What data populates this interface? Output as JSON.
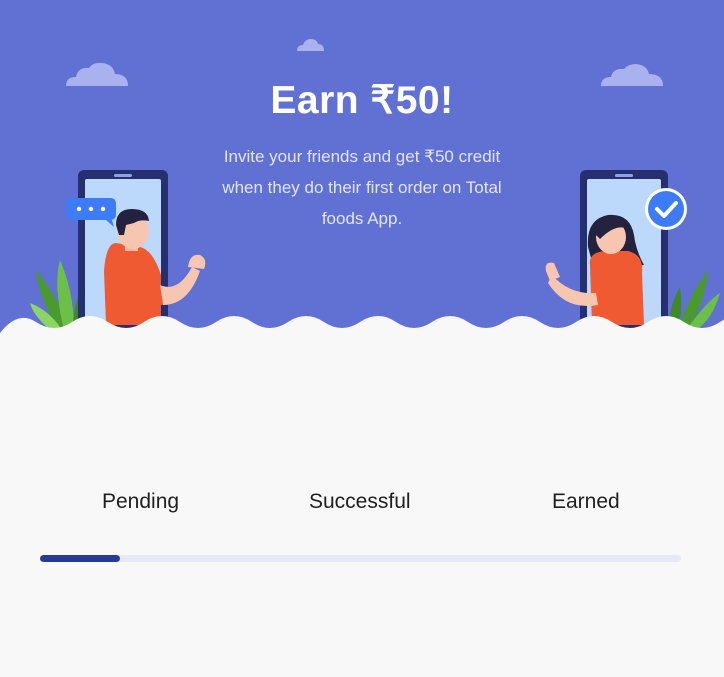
{
  "hero": {
    "title": "Earn ₹50!",
    "subtitle": "Invite your friends and get ₹50 credit when they do their first order on Total foods App."
  },
  "colors": {
    "hero_bg": "#6170d3",
    "page_bg": "#f8f8f8",
    "progress_fill": "#283a99",
    "progress_track": "#e8e9f7",
    "accent_orange": "#f05a33"
  },
  "icons": [
    "cloud-icon",
    "chat-bubble-icon",
    "checkmark-icon",
    "leaf-icon",
    "phone-icon"
  ],
  "tabs": [
    {
      "label": "Pending"
    },
    {
      "label": "Successful"
    },
    {
      "label": "Earned"
    }
  ],
  "progress": {
    "fraction": 0.125
  }
}
